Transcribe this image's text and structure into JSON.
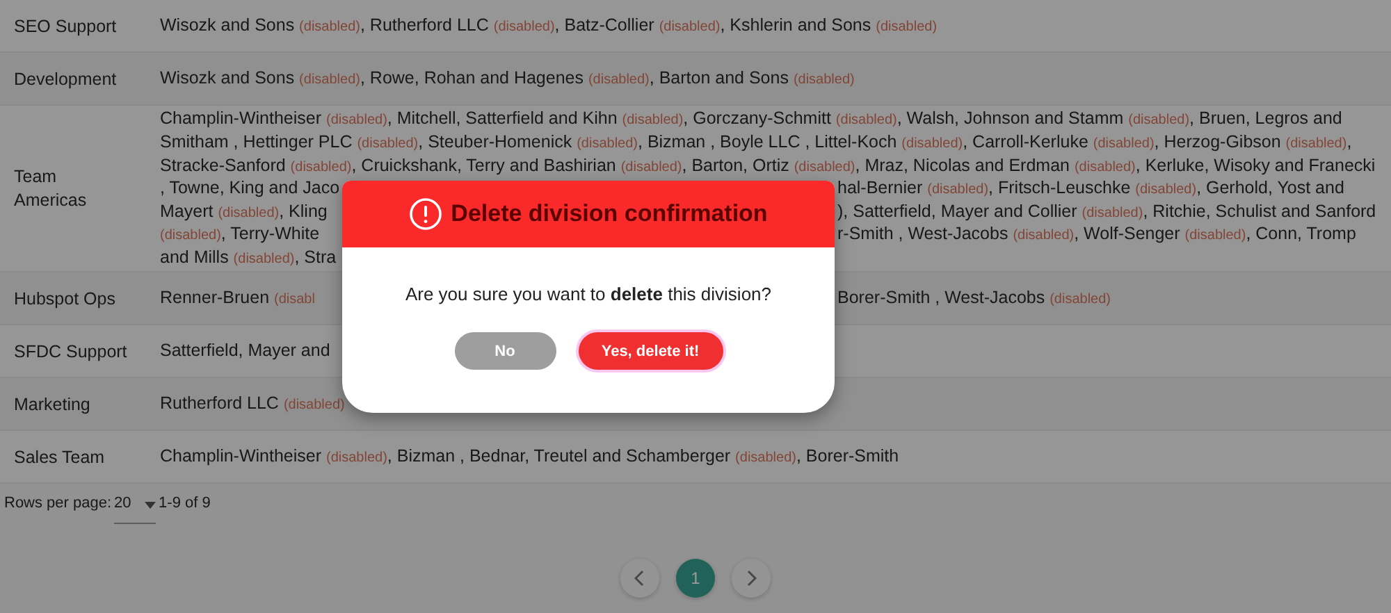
{
  "table": {
    "rows": [
      {
        "division": [
          "SEO Support"
        ],
        "lines": [
          {
            "left": [
              {
                "text": "Wisozk and Sons ",
                "kind": "name"
              },
              {
                "text": "(disabled)",
                "kind": "tag"
              },
              {
                "text": ", Rutherford LLC ",
                "kind": "name"
              },
              {
                "text": "(disabled)",
                "kind": "tag"
              },
              {
                "text": ", Batz-Collier ",
                "kind": "name"
              },
              {
                "text": "(disabled)",
                "kind": "tag"
              },
              {
                "text": ", Kshlerin and Sons ",
                "kind": "name"
              },
              {
                "text": "(disabled)",
                "kind": "tag"
              }
            ]
          }
        ]
      },
      {
        "division": [
          "Development"
        ],
        "lines": [
          {
            "left": [
              {
                "text": "Wisozk and Sons ",
                "kind": "name"
              },
              {
                "text": "(disabled)",
                "kind": "tag"
              },
              {
                "text": ", Rowe, Rohan and Hagenes ",
                "kind": "name"
              },
              {
                "text": "(disabled)",
                "kind": "tag"
              },
              {
                "text": ", Barton and Sons ",
                "kind": "name"
              },
              {
                "text": "(disabled)",
                "kind": "tag"
              }
            ]
          }
        ]
      },
      {
        "division": [
          "Team",
          "Americas"
        ],
        "lines": [
          {
            "left": [
              {
                "text": "Champlin-Wintheiser ",
                "kind": "name"
              },
              {
                "text": "(disabled)",
                "kind": "tag"
              },
              {
                "text": ", Mitchell, Satterfield and Kihn ",
                "kind": "name"
              },
              {
                "text": "(disabled)",
                "kind": "tag"
              },
              {
                "text": ", Gorczany-Schmitt ",
                "kind": "name"
              },
              {
                "text": "(disabled)",
                "kind": "tag"
              },
              {
                "text": ", Walsh, Johnson and Stamm ",
                "kind": "name"
              },
              {
                "text": "(disabled)",
                "kind": "tag"
              },
              {
                "text": ", Bruen, Legros and",
                "kind": "name"
              }
            ]
          },
          {
            "left": [
              {
                "text": "Smitham , Hettinger PLC ",
                "kind": "name"
              },
              {
                "text": "(disabled)",
                "kind": "tag"
              },
              {
                "text": ", Steuber-Homenick ",
                "kind": "name"
              },
              {
                "text": "(disabled)",
                "kind": "tag"
              },
              {
                "text": ", Bizman , Boyle LLC , Littel-Koch ",
                "kind": "name"
              },
              {
                "text": "(disabled)",
                "kind": "tag"
              },
              {
                "text": ", Carroll-Kerluke ",
                "kind": "name"
              },
              {
                "text": "(disabled)",
                "kind": "tag"
              },
              {
                "text": ", Herzog-Gibson ",
                "kind": "name"
              },
              {
                "text": "(disabled)",
                "kind": "tag"
              },
              {
                "text": ",",
                "kind": "name"
              }
            ]
          },
          {
            "left": [
              {
                "text": "Stracke-Sanford ",
                "kind": "name"
              },
              {
                "text": "(disabled)",
                "kind": "tag"
              },
              {
                "text": ", Cruickshank, Terry and Bashirian ",
                "kind": "name"
              },
              {
                "text": "(disabled)",
                "kind": "tag"
              },
              {
                "text": ", Barton, Ortiz ",
                "kind": "name"
              },
              {
                "text": "(disabled)",
                "kind": "tag"
              },
              {
                "text": ", Mraz, Nicolas and Erdman ",
                "kind": "name"
              },
              {
                "text": "(disabled)",
                "kind": "tag"
              },
              {
                "text": ", Kerluke, Wisoky and Franecki",
                "kind": "name"
              }
            ]
          },
          {
            "left": [
              {
                "text": ", Towne, King and Jaco",
                "kind": "name"
              }
            ],
            "right": [
              {
                "text": "hal-Bernier ",
                "kind": "name"
              },
              {
                "text": "(disabled)",
                "kind": "tag"
              },
              {
                "text": ", Fritsch-Leuschke ",
                "kind": "name"
              },
              {
                "text": "(disabled)",
                "kind": "tag"
              },
              {
                "text": ", Gerhold, Yost and",
                "kind": "name"
              }
            ]
          },
          {
            "left": [
              {
                "text": "Mayert ",
                "kind": "name"
              },
              {
                "text": "(disabled)",
                "kind": "tag"
              },
              {
                "text": ", Kling",
                "kind": "name"
              }
            ],
            "right": [
              {
                "text": "), Satterfield, Mayer and Collier ",
                "kind": "name"
              },
              {
                "text": "(disabled)",
                "kind": "tag"
              },
              {
                "text": ", Ritchie, Schulist and Sanford",
                "kind": "name"
              }
            ]
          },
          {
            "left": [
              {
                "text": "(disabled)",
                "kind": "tag"
              },
              {
                "text": ", Terry-White",
                "kind": "name"
              }
            ],
            "right": [
              {
                "text": "r-Smith , West-Jacobs ",
                "kind": "name"
              },
              {
                "text": "(disabled)",
                "kind": "tag"
              },
              {
                "text": ", Wolf-Senger ",
                "kind": "name"
              },
              {
                "text": "(disabled)",
                "kind": "tag"
              },
              {
                "text": ", Conn, Tromp",
                "kind": "name"
              }
            ]
          },
          {
            "left": [
              {
                "text": "and Mills ",
                "kind": "name"
              },
              {
                "text": "(disabled)",
                "kind": "tag"
              },
              {
                "text": ", Stra",
                "kind": "name"
              }
            ]
          }
        ]
      },
      {
        "division": [
          "Hubspot Ops"
        ],
        "lines": [
          {
            "left": [
              {
                "text": "Renner-Bruen ",
                "kind": "name"
              },
              {
                "text": "(disabl",
                "kind": "tag"
              }
            ],
            "right": [
              {
                "text": "Borer-Smith , West-Jacobs ",
                "kind": "name"
              },
              {
                "text": "(disabled)",
                "kind": "tag"
              }
            ]
          }
        ]
      },
      {
        "division": [
          "SFDC Support"
        ],
        "lines": [
          {
            "left": [
              {
                "text": "Satterfield, Mayer and",
                "kind": "name"
              }
            ]
          }
        ]
      },
      {
        "division": [
          "Marketing"
        ],
        "lines": [
          {
            "left": [
              {
                "text": "Rutherford LLC ",
                "kind": "name"
              },
              {
                "text": "(disabled)",
                "kind": "tag"
              }
            ]
          }
        ]
      },
      {
        "division": [
          "Sales Team"
        ],
        "lines": [
          {
            "left": [
              {
                "text": "Champlin-Wintheiser ",
                "kind": "name"
              },
              {
                "text": "(disabled)",
                "kind": "tag"
              },
              {
                "text": ", Bizman , Bednar, Treutel and Schamberger ",
                "kind": "name"
              },
              {
                "text": "(disabled)",
                "kind": "tag"
              },
              {
                "text": ", Borer-Smith",
                "kind": "name"
              }
            ]
          }
        ]
      }
    ]
  },
  "pagination": {
    "rows_per_page_label": "Rows per page:",
    "rows_per_page": "20",
    "range": "1-9 of 9",
    "pages": [
      {
        "label": "1",
        "selected": true
      }
    ]
  },
  "dialog": {
    "title": "Delete division confirmation",
    "message": "Are you sure you want to **delete** this division?",
    "buttons": [
      {
        "label": "No",
        "kind": "cancel"
      },
      {
        "label": "Yes, delete it!",
        "kind": "confirm"
      }
    ]
  }
}
